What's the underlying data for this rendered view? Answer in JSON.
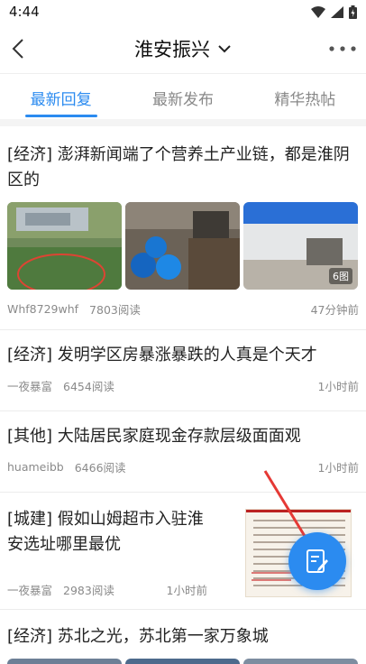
{
  "status": {
    "time": "4:44"
  },
  "nav": {
    "title": "淮安振兴"
  },
  "tabs": [
    {
      "label": "最新回复"
    },
    {
      "label": "最新发布"
    },
    {
      "label": "精华热帖"
    }
  ],
  "posts": [
    {
      "title": "[经济] 澎湃新闻端了个营养土产业链，都是淮阴区的",
      "author": "Whf8729whf",
      "reads": "7803阅读",
      "time": "47分钟前",
      "image_count": "6图"
    },
    {
      "title": "[经济] 发明学区房暴涨暴跌的人真是个天才",
      "author": "一夜暴富",
      "reads": "6454阅读",
      "time": "1小时前"
    },
    {
      "title": "[其他] 大陆居民家庭现金存款层级面面观",
      "author": "huameibb",
      "reads": "6466阅读",
      "time": "1小时前"
    },
    {
      "title": "[城建] 假如山姆超市入驻淮安选址哪里最优",
      "author": "一夜暴富",
      "reads": "2983阅读",
      "time": "1小时前"
    },
    {
      "title": "[经济] 苏北之光，苏北第一家万象城"
    }
  ],
  "colors": {
    "accent": "#2b8bf0",
    "arrow": "#e53935"
  }
}
